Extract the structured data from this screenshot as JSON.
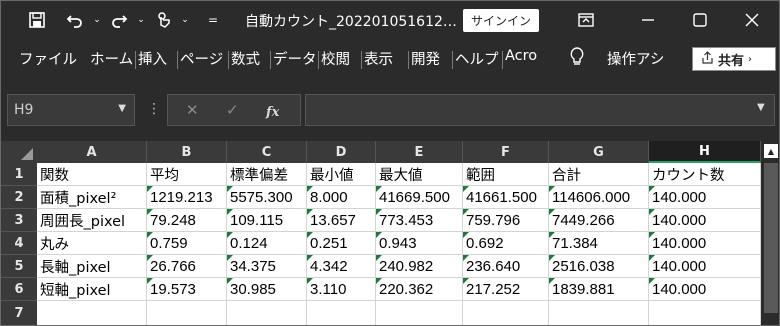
{
  "titlebar": {
    "save_icon": "save-icon",
    "undo_icon": "undo-icon",
    "redo_icon": "redo-icon",
    "touch_icon": "touch-mode-icon",
    "customize_icon": "customize-qat-icon",
    "title": "自動カウント_202201051612…",
    "signin": "サインイン",
    "ribbon_display_icon": "ribbon-display-icon",
    "minimize_icon": "minimize-icon",
    "maximize_icon": "maximize-icon",
    "close_icon": "close-icon"
  },
  "ribbon": {
    "tabs": [
      "ファイル",
      "ホーム",
      "挿入",
      "ページ",
      "数式",
      "データ",
      "校閲",
      "表示",
      "開発",
      "ヘルプ",
      "Acro"
    ],
    "tell_me_icon": "lightbulb-icon",
    "tell_me": "操作アシ",
    "share": "共有"
  },
  "formula_bar": {
    "name_box": "H9",
    "fx": "fx",
    "value": ""
  },
  "grid": {
    "columns": [
      "A",
      "B",
      "C",
      "D",
      "E",
      "F",
      "G",
      "H"
    ],
    "selected_column": "H",
    "rows": [
      "1",
      "2",
      "3",
      "4",
      "5",
      "6",
      "7"
    ],
    "cells": [
      [
        "関数",
        "平均",
        "標準偏差",
        "最小値",
        "最大値",
        "範囲",
        "合計",
        "カウント数"
      ],
      [
        "面積_pixel²",
        "1219.213",
        "5575.300",
        "8.000",
        "41669.500",
        "41661.500",
        "114606.000",
        "140.000"
      ],
      [
        "周囲長_pixel",
        "79.248",
        "109.115",
        "13.657",
        "773.453",
        "759.796",
        "7449.266",
        "140.000"
      ],
      [
        "丸み",
        "0.759",
        "0.124",
        "0.251",
        "0.943",
        "0.692",
        "71.384",
        "140.000"
      ],
      [
        "長軸_pixel",
        "26.766",
        "34.375",
        "4.342",
        "240.982",
        "236.640",
        "2516.038",
        "140.000"
      ],
      [
        "短軸_pixel",
        "19.573",
        "30.985",
        "3.110",
        "220.362",
        "217.252",
        "1839.881",
        "140.000"
      ],
      [
        "",
        "",
        "",
        "",
        "",
        "",
        "",
        ""
      ]
    ]
  },
  "colors": {
    "chrome": "#2b2b2b",
    "header": "#3a3a3a",
    "selected_accent": "#21a366",
    "number_marker": "#1e7a3c"
  }
}
